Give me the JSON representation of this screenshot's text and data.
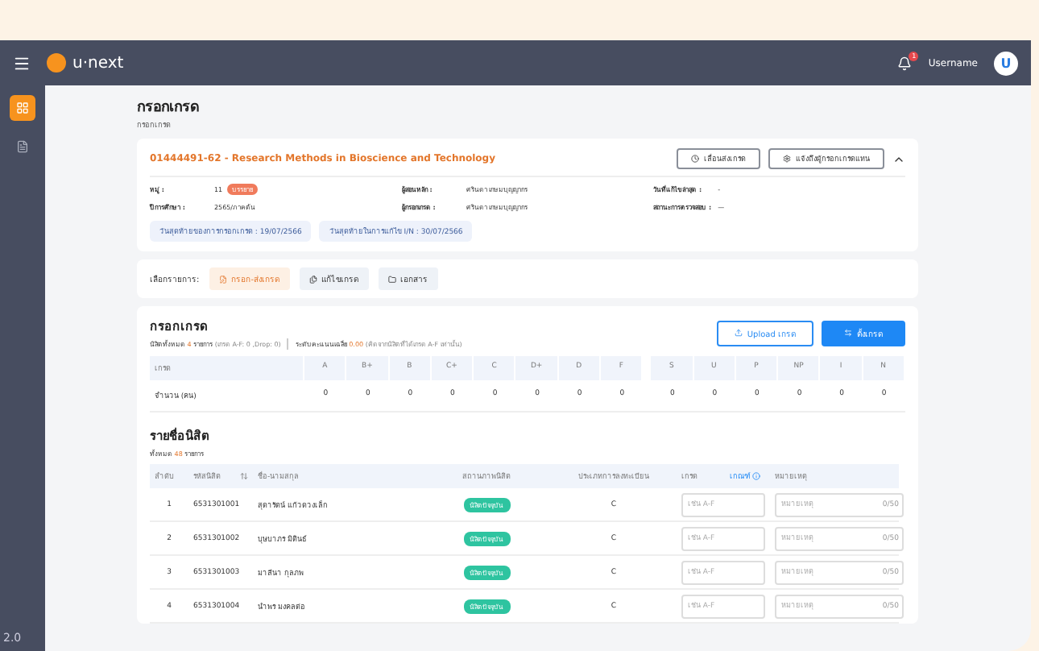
{
  "topbar": {
    "logo": "u·next",
    "notification_count": "1",
    "username": "Username",
    "avatar_letter": "U"
  },
  "sidebar": {
    "items": [
      {
        "selected": true
      },
      {
        "selected": false
      }
    ]
  },
  "page": {
    "title": "กรอกเกรด",
    "breadcrumb": "กรอกเกรด"
  },
  "course": {
    "title": "01444491-62 - Research Methods in Bioscience and Technology",
    "buttons": [
      "เลื่อนส่งเกรด",
      "แจ้งถึงผู้กรอกเกรดแทน"
    ],
    "expanded": true,
    "info": [
      {
        "label": "หมู่ :",
        "value": "11",
        "badge": "บรรยาย"
      },
      {
        "label": "ผู้สอนหลัก :",
        "value": "ศรินดา เกษมบุญญากร"
      },
      {
        "label": "วันที่แก้ไขล่าสุด :",
        "value": "-"
      },
      {
        "label": "ปีการศึกษา :",
        "value": "2565/ภาคต้น"
      },
      {
        "label": "ผู้กรอกเกรด :",
        "value": "ศรินดา เกษมบุญญากร"
      },
      {
        "label": "สถานะการตรวจสอบ :",
        "value": "—"
      }
    ],
    "chips": [
      "วันสุดท้ายของการกรอกเกรด : 19/07/2566",
      "วันสุดท้ายในการแก้ไข I/N : 30/07/2566"
    ]
  },
  "menu": {
    "label": "เลือกรายการ:",
    "tabs": [
      {
        "label": "กรอก-ส่งเกรด",
        "selected": true
      },
      {
        "label": "แก้ไขเกรด",
        "selected": false
      },
      {
        "label": "เอกสาร",
        "selected": false
      }
    ]
  },
  "grades": {
    "title": "กรอกเกรด",
    "summary": "นิสิตทั้งหมด **4** รายการ *(เกรด A-F: 0 ,Drop: 0)*",
    "average": "ระดับคะแนนเฉลี่ย **0.00** *(คิดจากนิสิตที่ได้เกรด A-F เท่านั้น)*",
    "upload_button": "Upload เกรด",
    "set_button": "ตั้งเกรด",
    "header_label": "เกรด",
    "row_label": "จำนวน (คน)",
    "group_1": [
      {
        "grade": "A",
        "count": "0"
      },
      {
        "grade": "B+",
        "count": "0"
      },
      {
        "grade": "B",
        "count": "0"
      },
      {
        "grade": "C+",
        "count": "0"
      },
      {
        "grade": "C",
        "count": "0"
      },
      {
        "grade": "D+",
        "count": "0"
      },
      {
        "grade": "D",
        "count": "0"
      },
      {
        "grade": "F",
        "count": "0"
      }
    ],
    "group_2": [
      {
        "grade": "S",
        "count": "0"
      },
      {
        "grade": "U",
        "count": "0"
      },
      {
        "grade": "P",
        "count": "0"
      },
      {
        "grade": "NP",
        "count": "0"
      },
      {
        "grade": "I",
        "count": "0"
      },
      {
        "grade": "N",
        "count": "0"
      }
    ]
  },
  "students": {
    "title": "รายชื่อนิสิต",
    "total_prefix": "ทั้งหมด",
    "total": "48",
    "total_suffix": "รายการ",
    "columns": [
      "ลำดับ",
      "รหัสนิสิต",
      "ชื่อ-นามสกุล",
      "สถานภาพนิสิต",
      "ประเภทการลงทะเบียน",
      "เกรด",
      "เกณฑ์",
      "หมายเหตุ"
    ],
    "rows": [
      {
        "no": "1",
        "id": "6531301001",
        "name": "สุดารัตน์ แก้วดวงเล็ก",
        "status": "นิสิตปัจจุบัน",
        "type": "C",
        "grade_placeholder": "เช่น A-F",
        "note_placeholder": "หมายเหตุ",
        "count": "0/50"
      },
      {
        "no": "2",
        "id": "6531301002",
        "name": "บุษบาภร มิตินธ์",
        "status": "นิสิตปัจจุบัน",
        "type": "C",
        "grade_placeholder": "เช่น A-F",
        "note_placeholder": "หมายเหตุ",
        "count": "0/50"
      },
      {
        "no": "3",
        "id": "6531301003",
        "name": "มาลีนา กุลภพ",
        "status": "นิสิตปัจจุบัน",
        "type": "C",
        "grade_placeholder": "เช่น A-F",
        "note_placeholder": "หมายเหตุ",
        "count": "0/50"
      },
      {
        "no": "4",
        "id": "6531301004",
        "name": "นำพร มงคลต่อ",
        "status": "นิสิตปัจจุบัน",
        "type": "C",
        "grade_placeholder": "เช่น A-F",
        "note_placeholder": "หมายเหตุ",
        "count": "0/50"
      }
    ]
  },
  "corner_text": "2.0"
}
